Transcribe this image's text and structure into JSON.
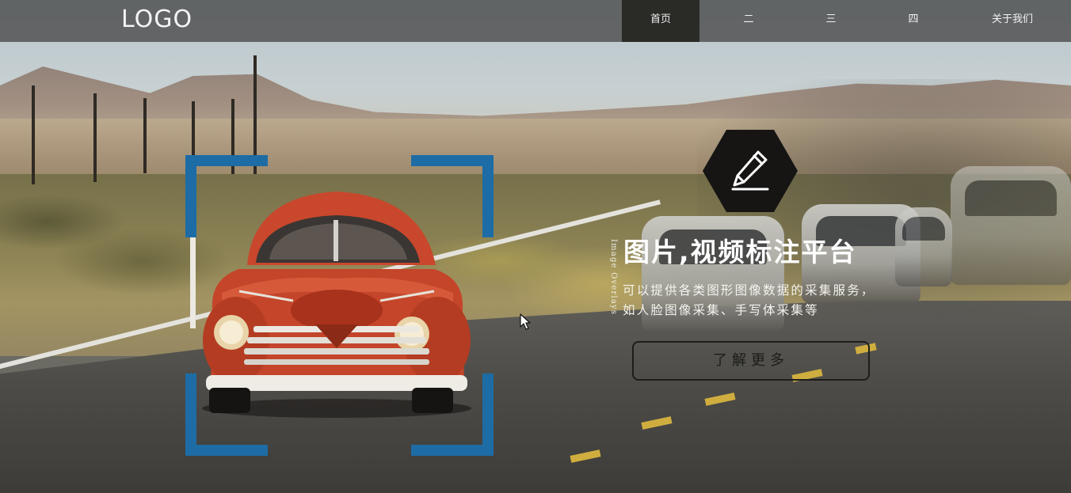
{
  "header": {
    "logo": "LOGO",
    "nav": [
      {
        "label": "首页",
        "active": true
      },
      {
        "label": "二",
        "active": false
      },
      {
        "label": "三",
        "active": false
      },
      {
        "label": "四",
        "active": false
      },
      {
        "label": "关于我们",
        "active": false
      }
    ]
  },
  "hero": {
    "icon": "pencil-icon",
    "vertical_label": "Image Overlays",
    "title": "图片,视频标注平台",
    "description_lines": [
      "可以提供各类图形图像数据的采集服务，",
      "如人脸图像采集、手写体采集等"
    ],
    "cta_label": "了解更多"
  },
  "colors": {
    "frame": "#1d6ca5",
    "nav_active": "#2a2a27",
    "hexagon": "#161514"
  }
}
